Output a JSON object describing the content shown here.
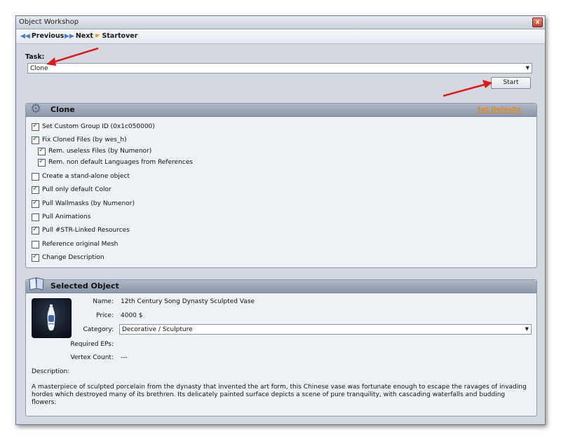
{
  "window": {
    "title": "Object Workshop",
    "close_glyph": "x"
  },
  "nav": {
    "previous": "Previous",
    "next": "Next",
    "startover": "Startover",
    "previous_icon": "double-left-arrow-icon",
    "next_icon": "double-right-arrow-icon",
    "startover_icon": "hand-pointer-icon"
  },
  "task": {
    "label": "Task:",
    "value": "Clone"
  },
  "start_button": "Start",
  "clone_panel": {
    "title": "Clone",
    "set_defaults": "Set Defaults",
    "options": [
      {
        "label": "Set Custom Group ID (0x1c050000)",
        "checked": true
      },
      {
        "label": "Fix Cloned Files (by wes_h)",
        "checked": true
      },
      {
        "label": "Rem. useless Files (by  Numenor)",
        "checked": true
      },
      {
        "label": "Rem. non default Languages from References",
        "checked": true
      },
      {
        "label": "Create a stand-alone object",
        "checked": false
      },
      {
        "label": "Pull only default Color",
        "checked": true
      },
      {
        "label": "Pull Wallmasks (by Numenor)",
        "checked": true
      },
      {
        "label": "Pull Animations",
        "checked": false
      },
      {
        "label": "Pull #STR-Linked Resources",
        "checked": true
      },
      {
        "label": "Reference original Mesh",
        "checked": false
      },
      {
        "label": "Change Description",
        "checked": true
      }
    ]
  },
  "selected_panel": {
    "title": "Selected Object",
    "name_label": "Name:",
    "name": "12th Century Song Dynasty Sculpted Vase",
    "price_label": "Price:",
    "price": "4000 $",
    "category_label": "Category:",
    "category": "Decorative / Sculpture",
    "eps_label": "Required EPs:",
    "eps": "",
    "vertex_label": "Vertex Count:",
    "vertex": "---",
    "description_label": "Description:",
    "description": "A masterpiece of sculpted porcelain from the dynasty that invented the art form, this Chinese vase was fortunate enough to escape the ravages of invading hordes which destroyed many of its brethren. Its delicately painted surface depicts a scene of pure tranquility, with cascading waterfalls and budding flowers."
  },
  "colors": {
    "accent_orange": "#e8891a",
    "annotation_red": "#e01818"
  }
}
